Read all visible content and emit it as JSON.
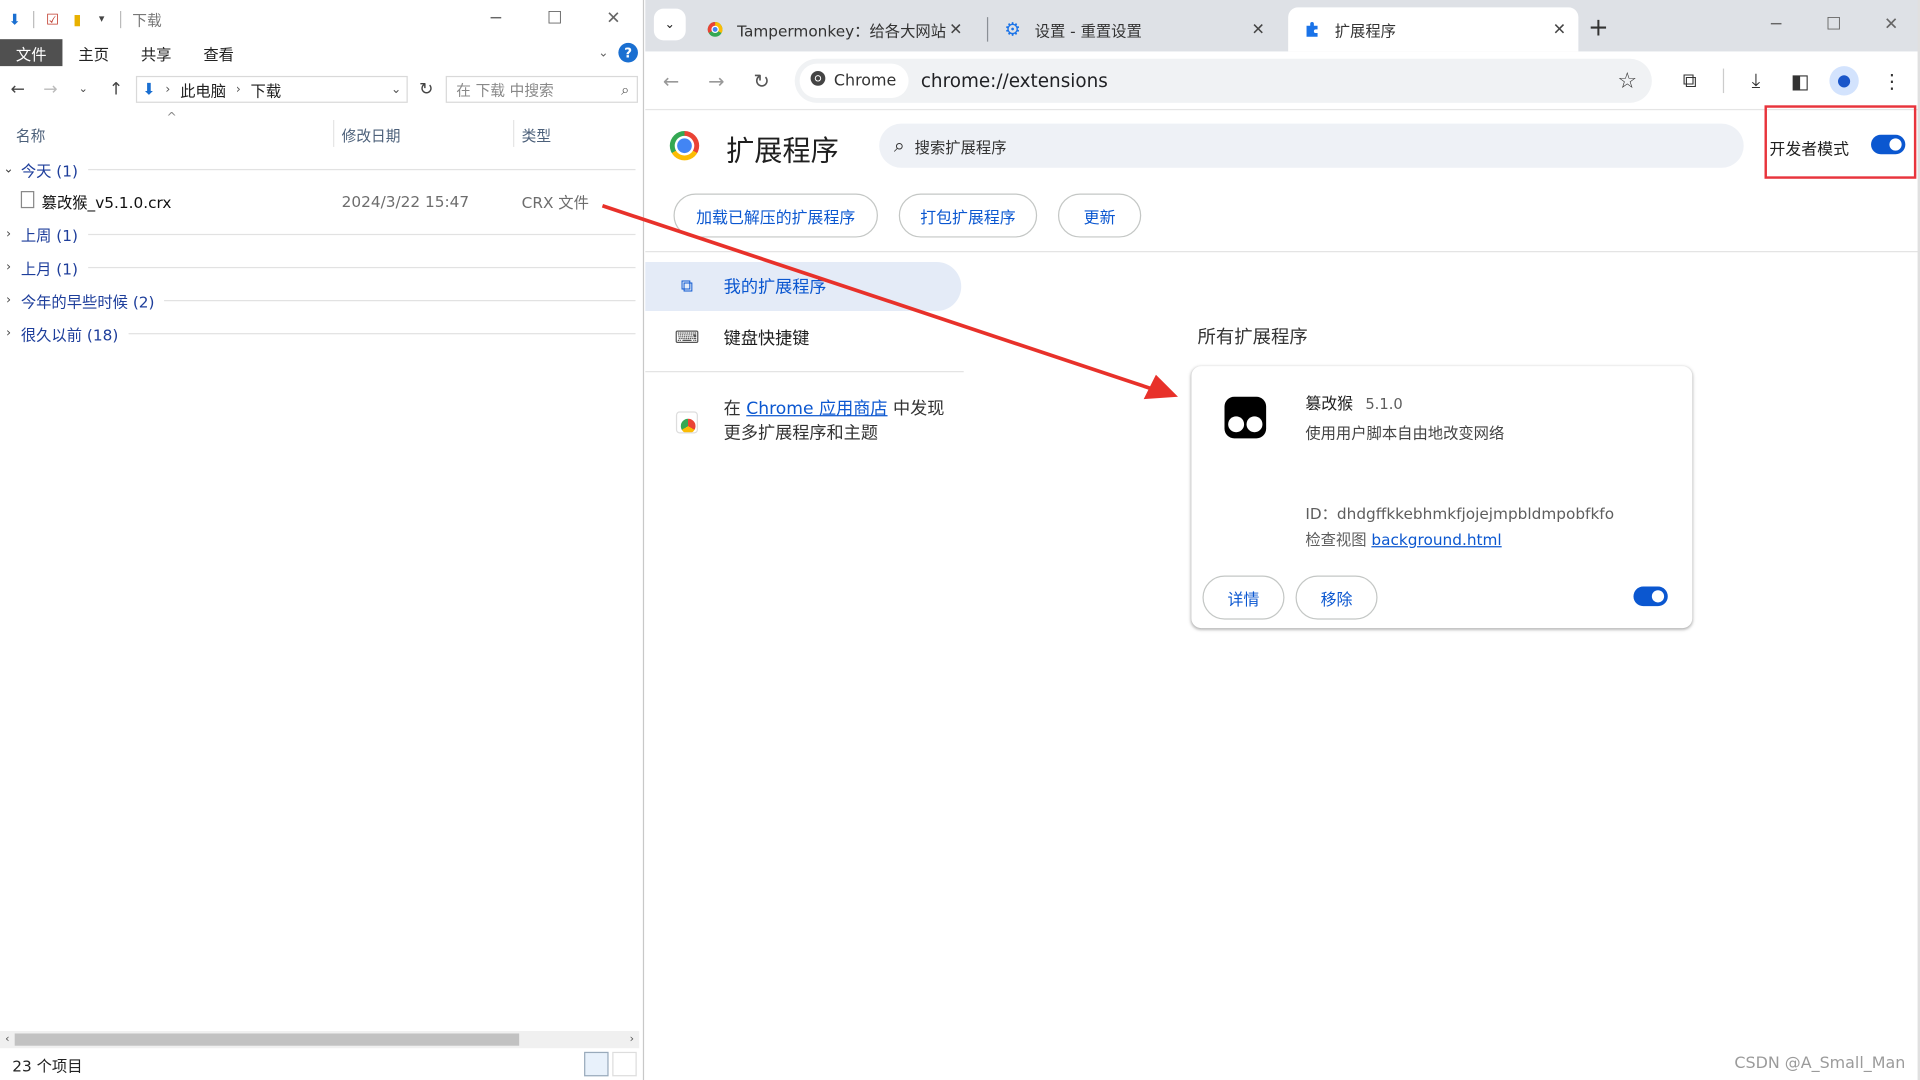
{
  "explorer": {
    "title": "下载",
    "ribbon_tabs": [
      "文件",
      "主页",
      "共享",
      "查看"
    ],
    "help_label": "?",
    "address": {
      "root": "此电脑",
      "folder": "下载"
    },
    "search_placeholder": "在 下载 中搜索",
    "columns": {
      "name": "名称",
      "date": "修改日期",
      "type": "类型"
    },
    "groups": [
      {
        "label": "今天 (1)",
        "expanded": true,
        "files": [
          {
            "name": "篡改猴_v5.1.0.crx",
            "date": "2024/3/22 15:47",
            "type": "CRX 文件"
          }
        ]
      },
      {
        "label": "上周 (1)",
        "expanded": false
      },
      {
        "label": "上月 (1)",
        "expanded": false
      },
      {
        "label": "今年的早些时候 (2)",
        "expanded": false
      },
      {
        "label": "很久以前 (18)",
        "expanded": false
      }
    ],
    "status": "23 个项目"
  },
  "chrome": {
    "tabs": [
      {
        "title": "Tampermonkey：给各大网站",
        "icon": "chrome-store-icon"
      },
      {
        "title": "设置 - 重置设置",
        "icon": "gear-icon"
      },
      {
        "title": "扩展程序",
        "icon": "puzzle-icon",
        "active": true
      }
    ],
    "omnibox": {
      "chip": "Chrome",
      "url": "chrome://extensions"
    },
    "page": {
      "title": "扩展程序",
      "search_placeholder": "搜索扩展程序",
      "dev_mode_label": "开发者模式",
      "dev_mode_on": true,
      "actions": [
        "加载已解压的扩展程序",
        "打包扩展程序",
        "更新"
      ],
      "sidebar": {
        "my_extensions": "我的扩展程序",
        "shortcuts": "键盘快捷键",
        "store_prefix": "在 ",
        "store_link": "Chrome 应用商店",
        "store_suffix": " 中发现",
        "store_line2": "更多扩展程序和主题"
      },
      "section_title": "所有扩展程序",
      "card": {
        "name": "篡改猴",
        "version": "5.1.0",
        "description": "使用用户脚本自由地改变网络",
        "id_label": "ID：",
        "id": "dhdgffkkebhmkfjojejmpbldmpobfkfo",
        "views_label": "检查视图 ",
        "views_link": "background.html",
        "details": "详情",
        "remove": "移除",
        "enabled": true
      }
    }
  },
  "watermark": "CSDN @A_Small_Man",
  "colors": {
    "accent": "#0b57d0",
    "highlight_box": "#e8343c",
    "arrow": "#e8312a"
  }
}
